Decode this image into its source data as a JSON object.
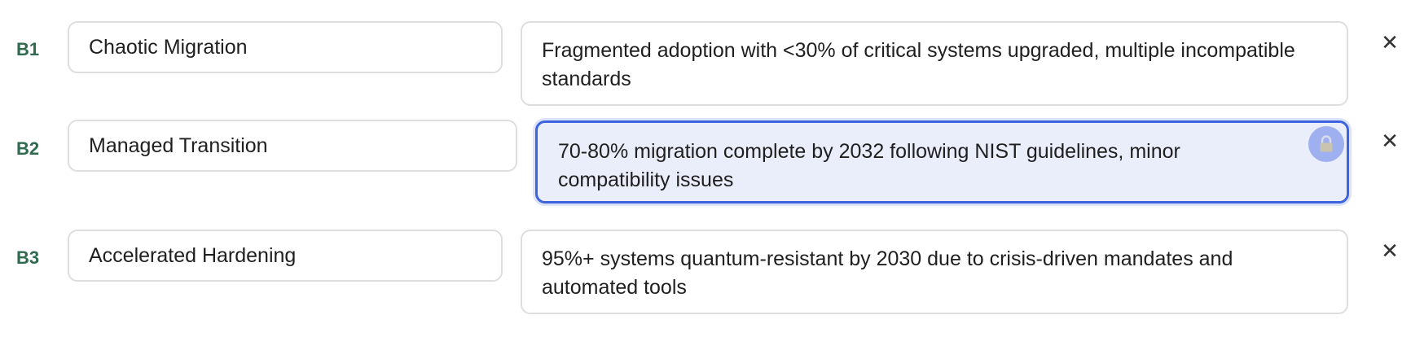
{
  "rows": [
    {
      "code": "B1",
      "name": "Chaotic Migration",
      "description": "Fragmented adoption with <30% of critical systems upgraded, multiple incompatible standards",
      "remove_icon": "close-icon",
      "remove_glyph": "✕"
    },
    {
      "code": "B2",
      "name": "Managed Transition",
      "description": "70-80% migration complete by 2032 following NIST guidelines, minor compatibility issues",
      "remove_icon": "close-icon",
      "remove_glyph": "✕",
      "focused": true,
      "lock_icon": "lock-icon"
    },
    {
      "code": "B3",
      "name": "Accelerated Hardening",
      "description": "95%+ systems quantum-resistant by 2030 due to crisis-driven mandates and automated tools",
      "remove_icon": "close-icon",
      "remove_glyph": "✕"
    }
  ],
  "colors": {
    "code_text": "#2f6b4f",
    "border": "#dedede",
    "focus_border": "#3d63dd",
    "focus_background": "#eaeefb",
    "lock_button": "#9fb0f0"
  }
}
